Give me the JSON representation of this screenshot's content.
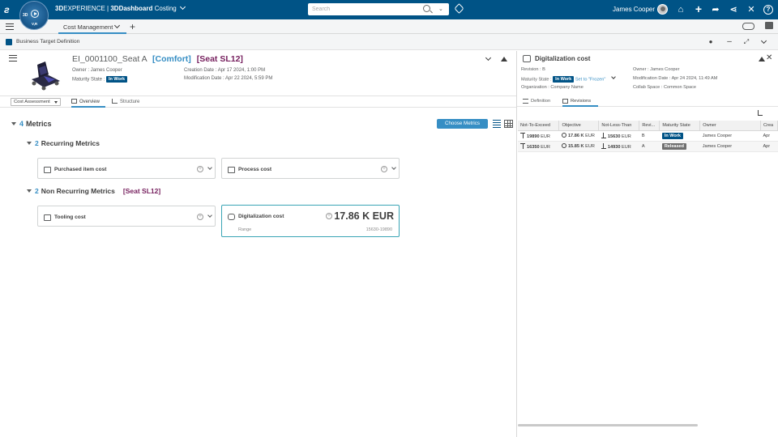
{
  "topbar": {
    "brand_3d": "3D",
    "brand_experience": "EXPERIENCE",
    "brand_sep": " | ",
    "brand_3d2": "3D",
    "brand_dashboard": "Dashboard",
    "brand_app": " Costing",
    "compass_label": "3D",
    "compass_version": "V,R",
    "search_placeholder": "Search",
    "user_name": "James Cooper",
    "icons": [
      "tag-icon",
      "share-icon",
      "add-icon",
      "forward-icon",
      "network-icon",
      "tools-icon",
      "help-icon"
    ]
  },
  "tabbar": {
    "active_tab": "Cost Management"
  },
  "widget": {
    "title": "Business Target Definition"
  },
  "object": {
    "name": "EI_0001100_Seat A",
    "tag_comfort": "[Comfort]",
    "tag_seat": "[Seat SL12]",
    "owner_label": "Owner : ",
    "owner": "James Cooper",
    "maturity_label": "Maturity State : ",
    "maturity": "In Work",
    "creation_label": "Creation Date : ",
    "creation": "Apr 17 2024, 1:00 PM",
    "modification_label": "Modification Date : ",
    "modification": "Apr 22 2024, 5:59 PM"
  },
  "subtoolbar": {
    "dropdown": "Cost Assessment",
    "tab_overview": "Overview",
    "tab_structure": "Structure"
  },
  "metrics": {
    "count": "4",
    "label": "Metrics",
    "choose_button": "Choose Metrics",
    "recurring": {
      "count": "2",
      "label": "Recurring Metrics",
      "cards": [
        {
          "title": "Purchased item cost"
        },
        {
          "title": "Process cost"
        }
      ]
    },
    "non_recurring": {
      "count": "2",
      "label": "Non Recurring Metrics",
      "tag": "[Seat SL12]",
      "cards": [
        {
          "title": "Tooling cost"
        },
        {
          "title": "Digitalization cost",
          "value": "17.86 K EUR",
          "range_label": "Range",
          "range_value": "15630-19890"
        }
      ]
    }
  },
  "right_panel": {
    "title": "Digitalization cost",
    "revision_label": "Revision : ",
    "revision": "B",
    "maturity_label": "Maturity State : ",
    "maturity": "In Work",
    "set_to": "Set to \"Frozen\"",
    "organization_label": "Organization : ",
    "organization": "Company Name",
    "owner_label": "Owner : ",
    "owner": "James Cooper",
    "modification_label": "Modification Date : ",
    "modification": "Apr 24 2024, 11:49 AM",
    "collab_label": "Collab Space : ",
    "collab": "Common Space",
    "tab_definition": "Definition",
    "tab_revisions": "Revisions",
    "table": {
      "headers": [
        "Not-To-Exceed",
        "Objective",
        "Not-Less-Than",
        "Revi...",
        "Maturity State",
        "Owner",
        "Crea"
      ],
      "rows": [
        {
          "nte": "19890",
          "nte_unit": "EUR",
          "obj": "17.86 K",
          "obj_unit": "EUR",
          "nlt": "15630",
          "nlt_unit": "EUR",
          "rev": "B",
          "state": "In Work",
          "owner": "James Cooper",
          "crea": "Apr"
        },
        {
          "nte": "16350",
          "nte_unit": "EUR",
          "obj": "15.85 K",
          "obj_unit": "EUR",
          "nlt": "14930",
          "nlt_unit": "EUR",
          "rev": "A",
          "state": "Released",
          "owner": "James Cooper",
          "crea": "Apr"
        }
      ]
    }
  },
  "colors": {
    "topbar": "#005386",
    "accent": "#368ec4",
    "tag_purple": "#77215f",
    "selected_card": "#3aa5b5"
  }
}
